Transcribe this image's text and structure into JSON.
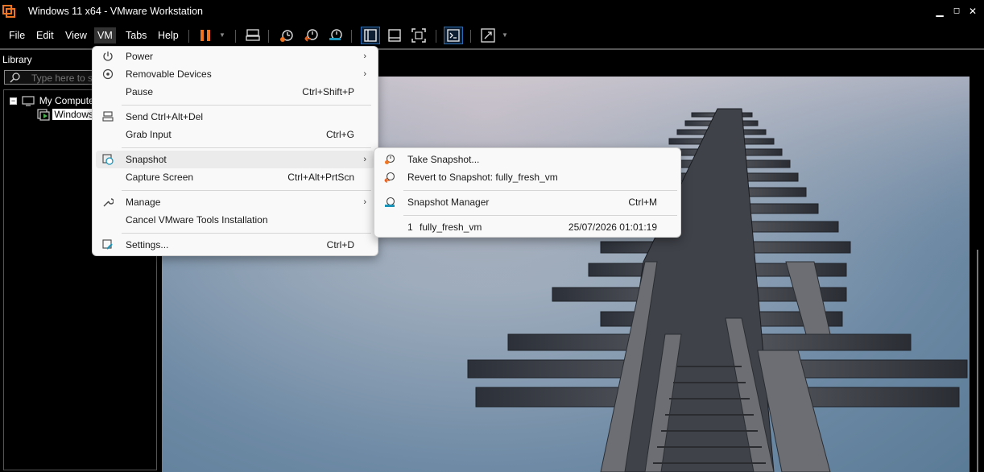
{
  "window": {
    "title": "Windows 11 x64 - VMware Workstation",
    "minimize": "▁",
    "restore": "◻",
    "close": "✕"
  },
  "menubar": {
    "items": [
      "File",
      "Edit",
      "View",
      "VM",
      "Tabs",
      "Help"
    ],
    "active": "VM"
  },
  "library": {
    "title": "Library",
    "search_placeholder": "Type here to s",
    "tree": [
      {
        "label": "My Compute",
        "expander": "−"
      },
      {
        "label": "Windows",
        "selected": true
      }
    ]
  },
  "vm_menu": {
    "items": [
      {
        "label": "Power",
        "shortcut": "",
        "submenu": true,
        "icon": "power-icon"
      },
      {
        "label": "Removable Devices",
        "shortcut": "",
        "submenu": true,
        "icon": "removable-devices-icon"
      },
      {
        "label": "Pause",
        "shortcut": "Ctrl+Shift+P",
        "submenu": false,
        "icon": ""
      },
      {
        "label": "Send Ctrl+Alt+Del",
        "shortcut": "",
        "submenu": false,
        "icon": "ctrl-alt-del-icon"
      },
      {
        "label": "Grab Input",
        "shortcut": "Ctrl+G",
        "submenu": false,
        "icon": ""
      },
      {
        "label": "Snapshot",
        "shortcut": "",
        "submenu": true,
        "icon": "snapshot-icon",
        "highlighted": true
      },
      {
        "label": "Capture Screen",
        "shortcut": "Ctrl+Alt+PrtScn",
        "submenu": false,
        "icon": ""
      },
      {
        "label": "Manage",
        "shortcut": "",
        "submenu": true,
        "icon": "wrench-icon"
      },
      {
        "label": "Cancel VMware Tools Installation",
        "shortcut": "",
        "submenu": false,
        "icon": ""
      },
      {
        "label": "Settings...",
        "shortcut": "Ctrl+D",
        "submenu": false,
        "icon": "settings-icon"
      }
    ],
    "arrow": "›"
  },
  "snapshot_menu": {
    "take": {
      "label": "Take Snapshot..."
    },
    "revert": {
      "label": "Revert to Snapshot: fully_fresh_vm"
    },
    "manager": {
      "label": "Snapshot Manager",
      "shortcut": "Ctrl+M"
    },
    "entries": [
      {
        "index": "1",
        "name": "fully_fresh_vm",
        "timestamp": "25/07/2026 01:01:19"
      }
    ]
  },
  "colors": {
    "accent_orange": "#f07522",
    "accent_blue": "#2a6db5",
    "snapshot_teal": "#1a93b8",
    "revert_orange": "#e8601c"
  }
}
